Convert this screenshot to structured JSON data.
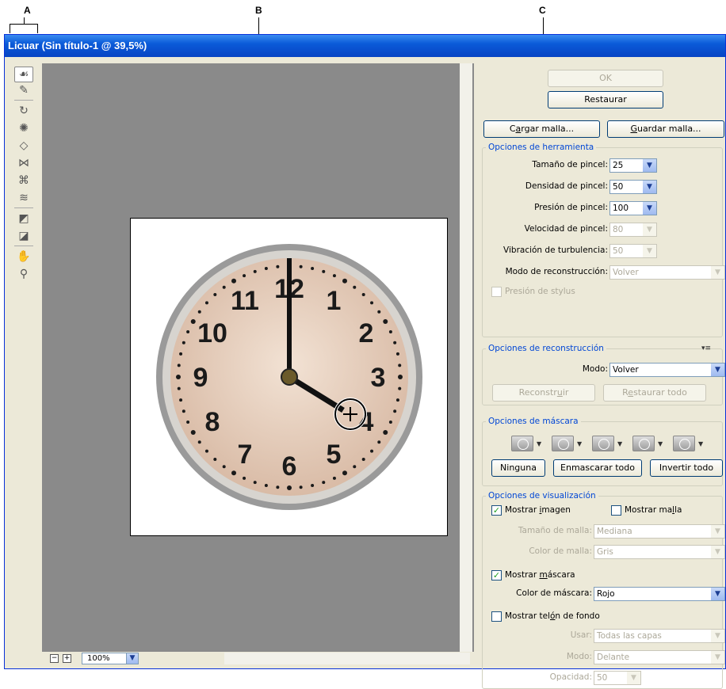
{
  "callouts": {
    "a": "A",
    "b": "B",
    "c": "C"
  },
  "window": {
    "title": "Licuar (Sin título-1 @ 39,5%)"
  },
  "toolbox": {
    "tools": [
      "warp-tool",
      "reconstruct-tool",
      "twirl-clockwise-tool",
      "pucker-tool",
      "bloat-tool",
      "push-left-tool",
      "mirror-tool",
      "turbulence-tool",
      "freeze-mask-tool",
      "thaw-mask-tool",
      "hand-tool",
      "zoom-tool"
    ]
  },
  "preview": {
    "zoom": "100%",
    "clock_numbers": [
      "12",
      "1",
      "2",
      "3",
      "4",
      "5",
      "6",
      "7",
      "8",
      "9",
      "10",
      "11"
    ]
  },
  "buttons": {
    "ok": "OK",
    "restore": "Restaurar",
    "load_mesh": "Cargar malla...",
    "save_mesh": "Guardar malla..."
  },
  "tool_options": {
    "title": "Opciones de herramienta",
    "brush_size_label": "Tamaño de pincel:",
    "brush_size": "25",
    "brush_density_label": "Densidad de pincel:",
    "brush_density": "50",
    "brush_pressure_label": "Presión de pincel:",
    "brush_pressure": "100",
    "brush_rate_label": "Velocidad de pincel:",
    "brush_rate": "80",
    "turbulent_jitter_label": "Vibración de turbulencia:",
    "turbulent_jitter": "50",
    "reconstruct_mode_label": "Modo de reconstrucción:",
    "reconstruct_mode": "Volver",
    "stylus_pressure": "Presión de stylus"
  },
  "reconstruct_options": {
    "title": "Opciones de reconstrucción",
    "mode_label": "Modo:",
    "mode": "Volver",
    "reconstruct_button": "Reconstruir",
    "restore_all_button": "Restaurar todo"
  },
  "mask_options": {
    "title": "Opciones de máscara",
    "none_button": "Ninguna",
    "mask_all_button": "Enmascarar todo",
    "invert_all_button": "Invertir todo"
  },
  "view_options": {
    "title": "Opciones de visualización",
    "show_image": "Mostrar imagen",
    "show_mesh": "Mostrar malla",
    "mesh_size_label": "Tamaño de malla:",
    "mesh_size": "Mediana",
    "mesh_color_label": "Color de malla:",
    "mesh_color": "Gris",
    "show_mask": "Mostrar máscara",
    "mask_color_label": "Color de máscara:",
    "mask_color": "Rojo",
    "show_backdrop": "Mostrar telón de fondo",
    "use_label": "Usar:",
    "use": "Todas las capas",
    "mode_label": "Modo:",
    "mode": "Delante",
    "opacity_label": "Opacidad:",
    "opacity": "50"
  },
  "colors": {
    "titlebar": "#0a5ad8",
    "panel": "#ece9d8",
    "preview_bg": "#8a8a8a",
    "group_title": "#0046d5"
  }
}
